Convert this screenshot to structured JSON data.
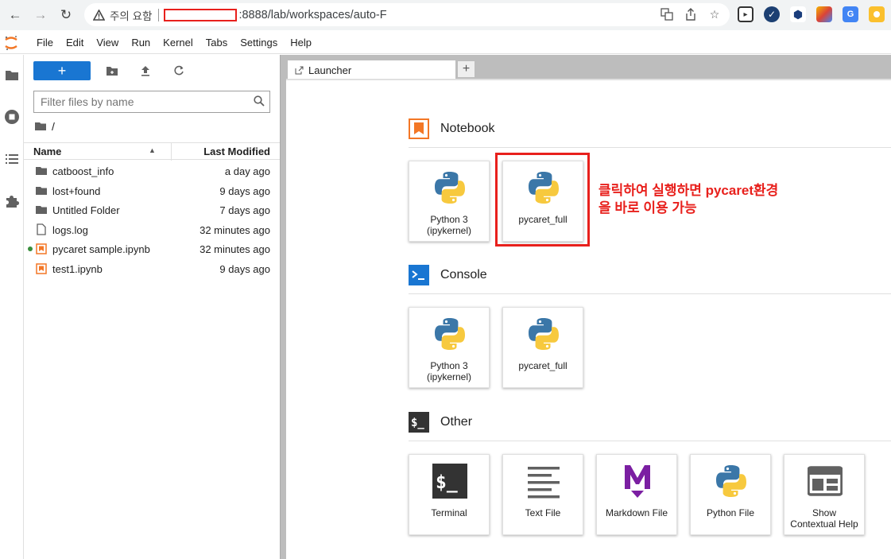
{
  "browser": {
    "warning_text": "주의 요함",
    "url": ":8888/lab/workspaces/auto-F"
  },
  "menu": [
    "File",
    "Edit",
    "View",
    "Run",
    "Kernel",
    "Tabs",
    "Settings",
    "Help"
  ],
  "filebrowser": {
    "new_label": "+",
    "filter_placeholder": "Filter files by name",
    "path": "/",
    "col_name": "Name",
    "col_modified": "Last Modified",
    "files": [
      {
        "name": "catboost_info",
        "modified": "a day ago",
        "type": "folder"
      },
      {
        "name": "lost+found",
        "modified": "9 days ago",
        "type": "folder"
      },
      {
        "name": "Untitled Folder",
        "modified": "7 days ago",
        "type": "folder"
      },
      {
        "name": "logs.log",
        "modified": "32 minutes ago",
        "type": "file"
      },
      {
        "name": "pycaret sample.ipynb",
        "modified": "32 minutes ago",
        "type": "notebook",
        "running": true
      },
      {
        "name": "test1.ipynb",
        "modified": "9 days ago",
        "type": "notebook"
      }
    ]
  },
  "tabs": [
    {
      "label": "Launcher"
    }
  ],
  "add_tab": "+",
  "launcher": {
    "notebook": {
      "title": "Notebook",
      "items": [
        {
          "line1": "Python 3",
          "line2": "(ipykernel)"
        },
        {
          "line1": "pycaret_full",
          "line2": ""
        }
      ]
    },
    "console": {
      "title": "Console",
      "items": [
        {
          "line1": "Python 3",
          "line2": "(ipykernel)"
        },
        {
          "line1": "pycaret_full",
          "line2": ""
        }
      ]
    },
    "other": {
      "title": "Other",
      "items": [
        {
          "line1": "Terminal",
          "line2": ""
        },
        {
          "line1": "Text File",
          "line2": ""
        },
        {
          "line1": "Markdown File",
          "line2": ""
        },
        {
          "line1": "Python File",
          "line2": ""
        },
        {
          "line1": "Show",
          "line2": "Contextual Help"
        }
      ]
    }
  },
  "annotation": {
    "line1": "클릭하여 실행하면 pycaret환경",
    "line2": "을 바로 이용 가능"
  },
  "colors": {
    "accent": "#1976d2",
    "highlight": "#e8201c",
    "notebook": "#f37726"
  }
}
